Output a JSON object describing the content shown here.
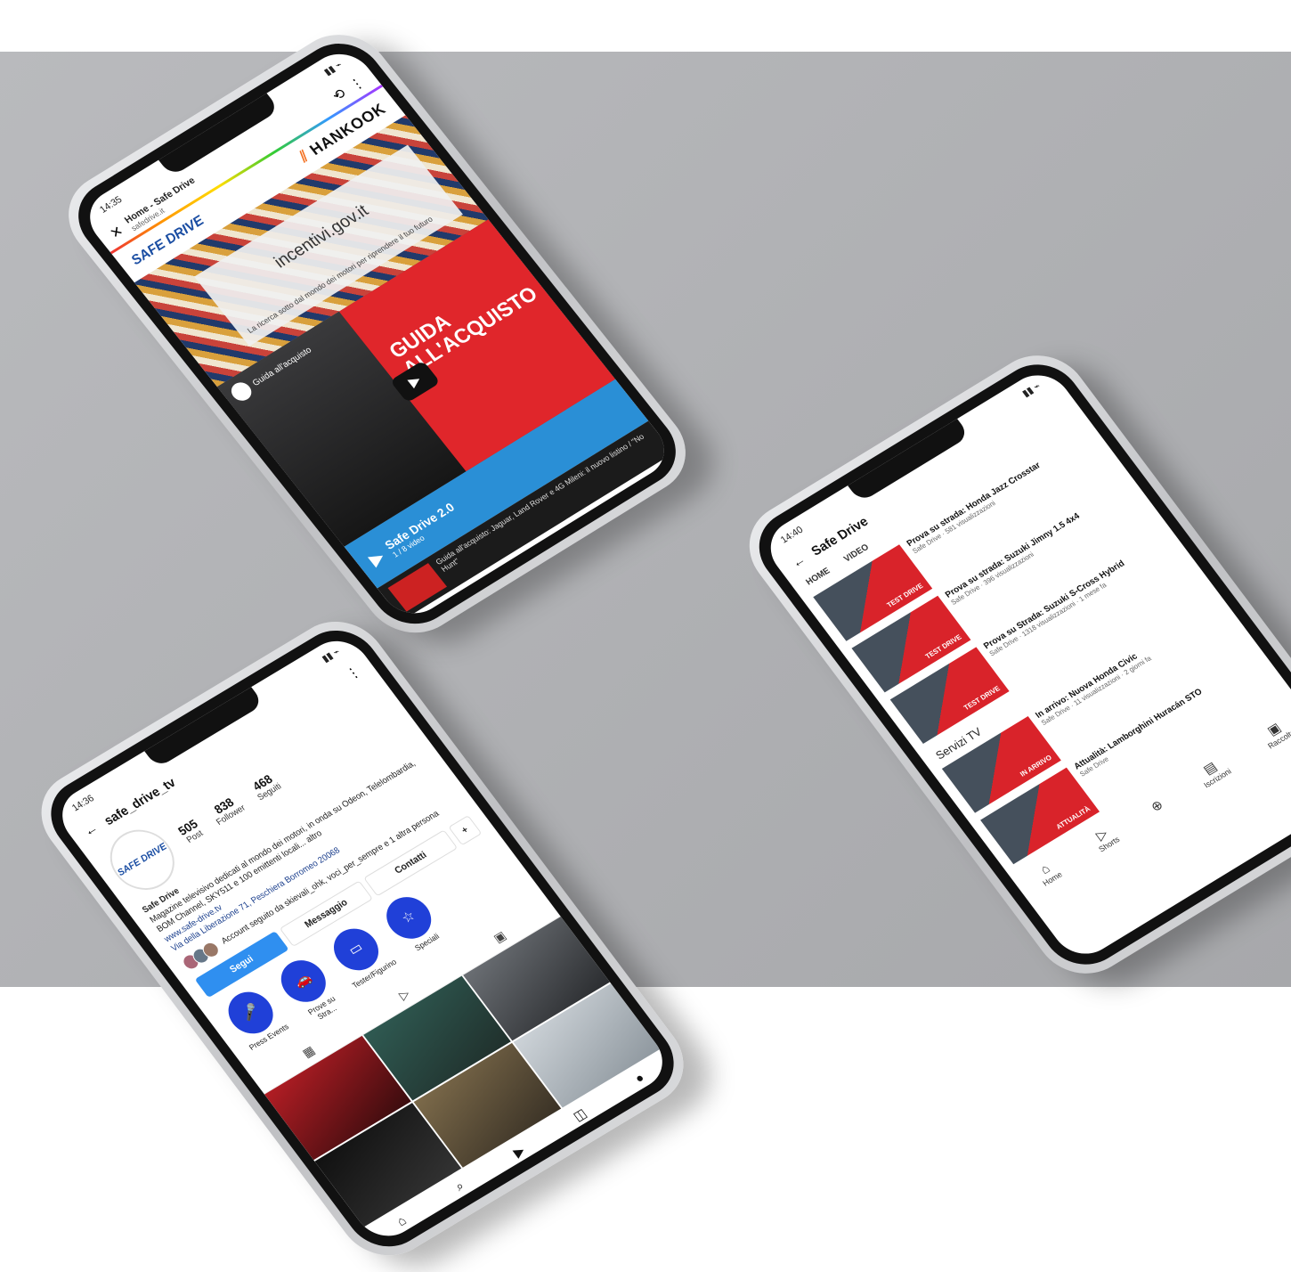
{
  "phone1": {
    "status_time": "14:35",
    "tab_title": "Home - Safe Drive",
    "tab_url": "safedrive.it",
    "logo_left": "SAFE DRIVE",
    "logo_right": "HANKOOK",
    "banner_url": "incentivi.gov.it",
    "banner_caption": "La ricerca sotto dal mondo dei motori per riprendere il tuo futuro",
    "channel": "Guida all'acquisto",
    "video_title": "GUIDA ALL'ACQUISTO",
    "playlist_title": "Safe Drive 2.0",
    "playlist_sub": "1 / 8 video",
    "playlist_item": "Guida all'acquisto: Jaguar, Land Rover e 4G Mileni: il nuovo listino / \"No Hunt\""
  },
  "phone2": {
    "status_time": "14:36",
    "username": "safe_drive_tv",
    "stats": [
      {
        "value": "505",
        "label": "Post"
      },
      {
        "value": "838",
        "label": "Follower"
      },
      {
        "value": "468",
        "label": "Seguiti"
      }
    ],
    "bio_name": "Safe Drive",
    "bio_lines": [
      "Magazine televisivo dedicati al mondo dei motori, in onda su Odeon, Telelombardia, BOM Channel, SKY511 e 100 emittenti locali... altro",
      "www.safe-drive.tv",
      "Via della Liberazione 71, Peschiera Borromeo 20068"
    ],
    "followed_by": "Account seguito da skievali_ohk, voci_per_sempre e 1 altra persona",
    "buttons": {
      "follow": "Segui",
      "message": "Messaggio",
      "contacts": "Contatti",
      "more": "+"
    },
    "highlights": [
      "Press Events",
      "Prove su Stra...",
      "Tester/Figurino",
      "Speciali"
    ]
  },
  "phone3": {
    "status_time": "14:40",
    "title": "Safe Drive",
    "tabs": [
      "HOME",
      "VIDEO"
    ],
    "videos": [
      {
        "title": "Prova su strada: Honda Jazz Crosstar",
        "sub": "Safe Drive · 581 visualizzazioni",
        "badge": "TEST DRIVE"
      },
      {
        "title": "Prova su strada: Suzuki Jimny 1.5 4x4",
        "sub": "Safe Drive · 396 visualizzazioni",
        "badge": "TEST DRIVE"
      },
      {
        "title": "Prova su Strada: Suzuki S-Cross Hybrid",
        "sub": "Safe Drive · 1318 visualizzazioni · 1 mese fa",
        "badge": "TEST DRIVE"
      }
    ],
    "section": "Servizi TV",
    "services": [
      {
        "title": "In arrivo: Nuova Honda Civic",
        "sub": "Safe Drive · 11 visualizzazioni · 2 giorni fa",
        "badge": "IN ARRIVO"
      },
      {
        "title": "Attualità: Lamborghini Huracán STO",
        "sub": "Safe Drive",
        "badge": "ATTUALITÀ"
      }
    ],
    "nav": [
      "Home",
      "Shorts",
      "",
      "Iscrizioni",
      "Raccolta"
    ]
  }
}
